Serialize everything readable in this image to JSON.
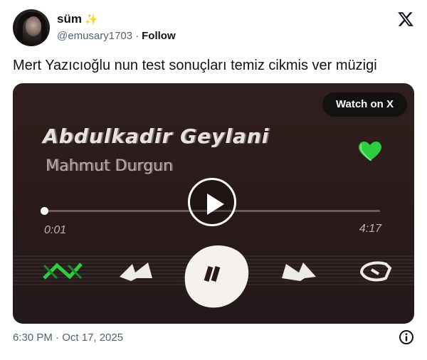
{
  "author": {
    "display_name": "süm",
    "emoji": "✨",
    "handle": "@emusary1703",
    "separator": "·",
    "follow_label": "Follow"
  },
  "tweet": {
    "text": "Mert Yazıcıoğlu nun test sonuçları temiz cikmis ver müzigi",
    "timestamp": "6:30 PM · Oct 17, 2025"
  },
  "media": {
    "watch_label": "Watch on X",
    "song_title": "Abdulkadir Geylani",
    "artist": "Mahmut Durgun",
    "elapsed": "0:01",
    "total": "4:17",
    "progress": 0.004
  },
  "icons": {
    "logo": "x-logo-icon",
    "play": "play-icon",
    "heart": "heart-icon",
    "info": "info-icon",
    "shuffle": "shuffle-icon",
    "previous": "previous-icon",
    "pause": "pause-icon",
    "next": "next-icon",
    "repeat": "repeat-icon"
  },
  "colors": {
    "heart": "#2ecc40",
    "shuffle": "#2ecc40",
    "text_secondary": "#536471"
  }
}
